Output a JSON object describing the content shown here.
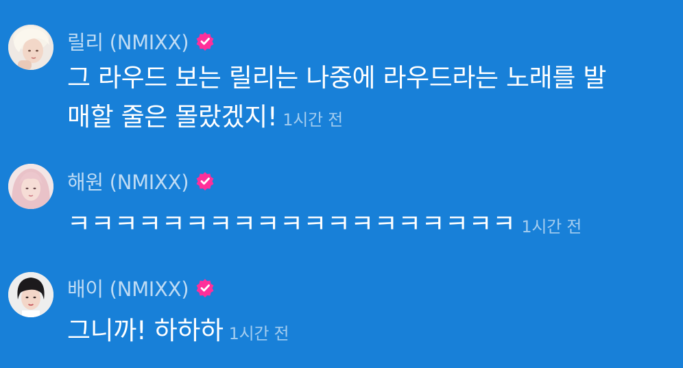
{
  "comments": [
    {
      "author": "릴리 (NMIXX)",
      "verified_icon": "verified-check-icon",
      "text_line1": "그 라우드 보는 릴리는 나중에 라우드라는 노래를 발",
      "text_line2": "매할 줄은 몰랐겠지!",
      "time": "1시간 전"
    },
    {
      "author": "해원 (NMIXX)",
      "verified_icon": "verified-check-icon",
      "text_line1": "ㅋㅋㅋㅋㅋㅋㅋㅋㅋㅋㅋㅋㅋㅋㅋㅋㅋㅋㅋ",
      "time": "1시간 전"
    },
    {
      "author": "배이 (NMIXX)",
      "verified_icon": "verified-check-icon",
      "text_line1": "그니까! 하하하",
      "time": "1시간 전"
    }
  ],
  "colors": {
    "background": "#1880d8",
    "verified_badge": "#ff2f9a",
    "text": "#ffffff"
  }
}
